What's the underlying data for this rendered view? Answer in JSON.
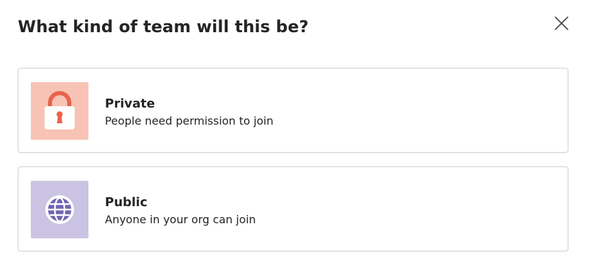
{
  "dialog": {
    "title": "What kind of team will this be?",
    "close_icon": "close-icon"
  },
  "options": [
    {
      "title": "Private",
      "description": "People need permission to join",
      "icon": "lock-icon",
      "tile_color": "#f8c3b5",
      "icon_color": "#e8644a"
    },
    {
      "title": "Public",
      "description": "Anyone in your org can join",
      "icon": "globe-icon",
      "tile_color": "#cbc3e2",
      "icon_color": "#6f63b3"
    }
  ]
}
